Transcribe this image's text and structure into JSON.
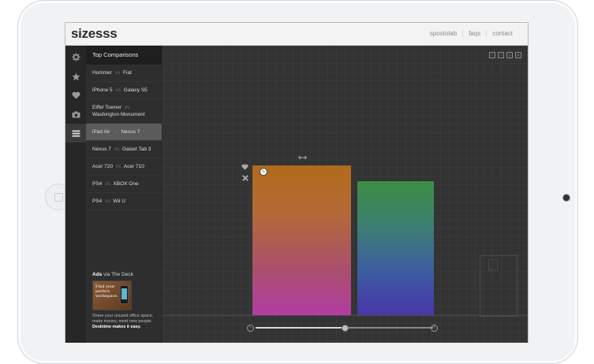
{
  "app": {
    "logo": "sizesss",
    "nav": [
      "spostolab",
      "faqs",
      "contact"
    ]
  },
  "rail_icons": [
    "gear-icon",
    "star-icon",
    "heart-icon",
    "camera-icon",
    "list-icon"
  ],
  "sidebar": {
    "title": "Top Comparisons",
    "vs_label": "vs",
    "comparisons": [
      {
        "a": "Hummer",
        "b": "Fiat"
      },
      {
        "a": "iPhone 5",
        "b": "Galaxy S5"
      },
      {
        "a": "Eiffel Towner",
        "b": "Washington Monument"
      },
      {
        "a": "iPad Air",
        "b": "Nexus 7"
      },
      {
        "a": "Nexus 7",
        "b": "Galaxt Tab 3"
      },
      {
        "a": "Acer 720",
        "b": "Acer 710"
      },
      {
        "a": "PS4",
        "b": "XBOX One"
      },
      {
        "a": "PS4",
        "b": "Wii U"
      }
    ],
    "selected_index": 3
  },
  "ads": {
    "label": "Ads",
    "via": "via The Deck",
    "image_text": "Find your perfect workspace.",
    "copy_plain": "Share your unused office space, make money, meet new people. ",
    "copy_bold_1": "Desktime",
    "copy_bold_2": "makes it easy."
  },
  "share_icons": [
    "twitter-icon",
    "facebook-icon",
    "google-plus-icon",
    "email-icon"
  ],
  "canvas": {
    "zoom_level": 0.5,
    "colors": {
      "bar1_top": "#b16a1d",
      "bar1_bottom": "#b23da3",
      "bar2_top": "#3b8e43",
      "bar2_bottom": "#4a35a8"
    }
  }
}
